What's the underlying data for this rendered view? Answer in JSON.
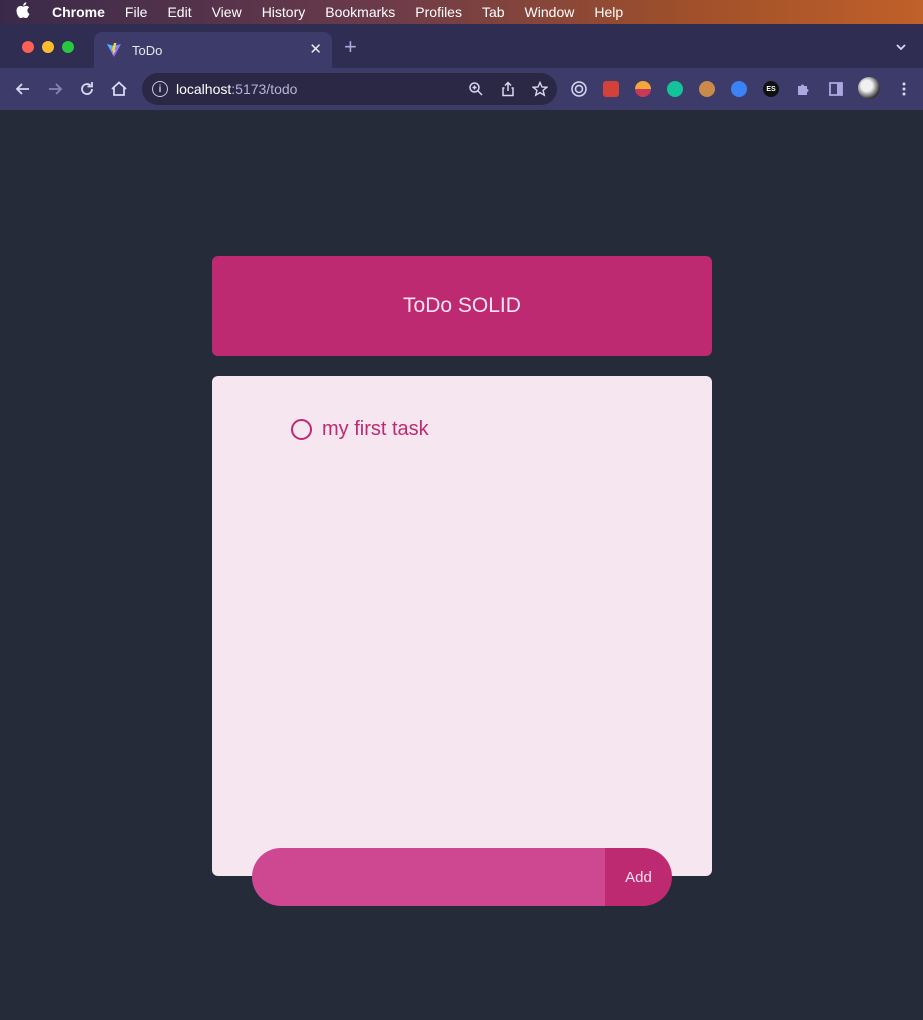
{
  "os_menu": {
    "app": "Chrome",
    "items": [
      "File",
      "Edit",
      "View",
      "History",
      "Bookmarks",
      "Profiles",
      "Tab",
      "Window",
      "Help"
    ]
  },
  "browser": {
    "tab_title": "ToDo",
    "address": {
      "host": "localhost",
      "path": ":5173/todo"
    }
  },
  "app": {
    "title": "ToDo SOLID",
    "tasks": [
      {
        "label": "my first task",
        "done": false
      }
    ],
    "add": {
      "placeholder": "",
      "value": "",
      "button_label": "Add"
    }
  },
  "colors": {
    "page_bg": "#262b3a",
    "header_bg": "#bd2a72",
    "list_bg": "#f6e6f0",
    "input_bg": "#cd4891",
    "accent": "#bd2a72"
  }
}
